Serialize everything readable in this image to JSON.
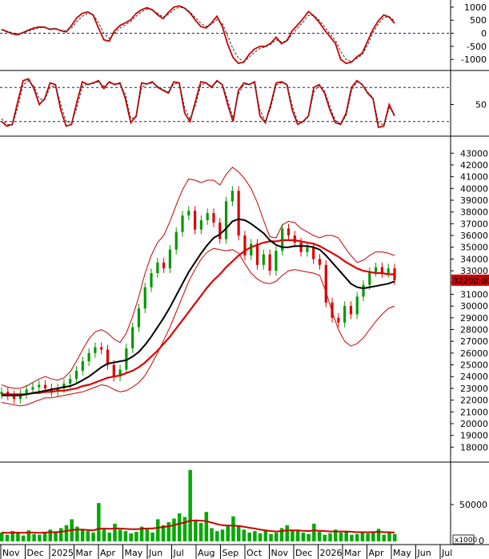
{
  "chart_data": [
    {
      "panel": "macd",
      "type": "line",
      "y_ticks": [
        "1000",
        "500",
        "0",
        "-500",
        "-1000"
      ],
      "y_tick_values": [
        1000,
        500,
        0,
        -500,
        -1000
      ],
      "ylim": [
        -1300,
        1150
      ],
      "reference_lines": [
        0
      ],
      "series": [
        {
          "color": "#cc0000",
          "style": "solid",
          "values": [
            150,
            60,
            -20,
            -60,
            30,
            120,
            200,
            240,
            230,
            150,
            180,
            100,
            50,
            300,
            600,
            760,
            820,
            700,
            200,
            -250,
            -300,
            100,
            300,
            400,
            520,
            760,
            900,
            980,
            900,
            700,
            560,
            800,
            1000,
            1050,
            960,
            780,
            500,
            260,
            200,
            400,
            650,
            260,
            -420,
            -930,
            -1150,
            -1100,
            -800,
            -600,
            -500,
            -500,
            -380,
            -150,
            -400,
            -280,
            100,
            320,
            560,
            830,
            660,
            420,
            120,
            -130,
            -380,
            -1000,
            -1150,
            -1100,
            -900,
            -760,
            -300,
            150,
            480,
            700,
            620,
            380
          ]
        },
        {
          "color": "#333333",
          "style": "dashed",
          "values": [
            120,
            80,
            20,
            -20,
            10,
            80,
            160,
            210,
            220,
            170,
            170,
            120,
            80,
            200,
            450,
            650,
            760,
            720,
            400,
            0,
            -200,
            0,
            200,
            330,
            450,
            650,
            820,
            920,
            900,
            760,
            620,
            720,
            900,
            1000,
            960,
            820,
            600,
            380,
            260,
            340,
            520,
            380,
            -100,
            -600,
            -950,
            -1080,
            -920,
            -720,
            -580,
            -520,
            -420,
            -250,
            -330,
            -300,
            -40,
            200,
            430,
            680,
            680,
            500,
            250,
            -30,
            -260,
            -700,
            -1000,
            -1080,
            -960,
            -820,
            -450,
            20,
            360,
            600,
            640,
            480
          ]
        }
      ]
    },
    {
      "panel": "stochastic",
      "type": "line",
      "y_ticks": [
        "50"
      ],
      "y_tick_values": [
        50
      ],
      "ylim": [
        0,
        100
      ],
      "reference_lines": [
        80,
        20
      ],
      "series": [
        {
          "color": "#cc0000",
          "style": "solid",
          "values": [
            20,
            12,
            15,
            55,
            92,
            95,
            78,
            50,
            60,
            88,
            85,
            40,
            12,
            15,
            55,
            90,
            85,
            88,
            92,
            78,
            90,
            85,
            88,
            60,
            18,
            30,
            88,
            86,
            90,
            80,
            75,
            70,
            90,
            88,
            35,
            20,
            55,
            90,
            88,
            80,
            92,
            85,
            50,
            20,
            75,
            88,
            85,
            90,
            30,
            18,
            50,
            88,
            90,
            85,
            40,
            15,
            20,
            30,
            80,
            85,
            70,
            40,
            18,
            15,
            35,
            80,
            92,
            85,
            70,
            60,
            10,
            12,
            50,
            30
          ]
        },
        {
          "color": "#333333",
          "style": "dashed",
          "values": [
            25,
            15,
            14,
            45,
            85,
            92,
            82,
            60,
            58,
            80,
            84,
            50,
            20,
            18,
            45,
            82,
            86,
            87,
            90,
            82,
            88,
            86,
            86,
            68,
            25,
            28,
            80,
            86,
            88,
            82,
            76,
            72,
            86,
            88,
            45,
            24,
            48,
            84,
            88,
            82,
            90,
            86,
            58,
            26,
            68,
            85,
            86,
            88,
            40,
            20,
            44,
            84,
            88,
            86,
            48,
            20,
            20,
            28,
            72,
            84,
            74,
            46,
            22,
            16,
            30,
            74,
            90,
            86,
            72,
            62,
            18,
            14,
            44,
            32
          ]
        }
      ]
    },
    {
      "panel": "price",
      "type": "candlestick",
      "y_ticks": [
        "43000",
        "42000",
        "41000",
        "40000",
        "39000",
        "38000",
        "37000",
        "36000",
        "35000",
        "34000",
        "33000",
        "32000",
        "31000",
        "30000",
        "29000",
        "28000",
        "27000",
        "26000",
        "25000",
        "24000",
        "23000",
        "22000",
        "21000",
        "20000",
        "19000",
        "18000"
      ],
      "y_tick_values": [
        43000,
        42000,
        41000,
        40000,
        39000,
        38000,
        37000,
        36000,
        35000,
        34000,
        33000,
        32000,
        31000,
        30000,
        29000,
        28000,
        27000,
        26000,
        25000,
        24000,
        23000,
        22000,
        21000,
        20000,
        19000,
        18000
      ],
      "ylim": [
        17000,
        43700
      ],
      "last_price_label": "32200.00",
      "last_price": 32200,
      "closes": [
        22700,
        22400,
        22100,
        22500,
        22900,
        23100,
        23300,
        23000,
        22700,
        23000,
        23400,
        23800,
        24500,
        25300,
        26000,
        26500,
        26300,
        25000,
        24000,
        24600,
        26400,
        28200,
        29800,
        31600,
        32800,
        33700,
        33200,
        34800,
        36300,
        37700,
        38100,
        36500,
        37300,
        37900,
        37100,
        35700,
        38900,
        39800,
        36000,
        34300,
        35300,
        33500,
        34400,
        33000,
        34700,
        36600,
        36000,
        35400,
        34600,
        35000,
        34000,
        33500,
        30300,
        29000,
        28600,
        30000,
        29300,
        30800,
        31800,
        32900,
        33300,
        32800,
        33200,
        32200
      ],
      "opens": [
        22500,
        22700,
        22400,
        22100,
        22500,
        22900,
        23100,
        23300,
        23000,
        22700,
        23000,
        23400,
        23800,
        24500,
        25300,
        26000,
        26500,
        26300,
        25000,
        24000,
        24600,
        26400,
        28200,
        29800,
        31600,
        32800,
        33700,
        33200,
        34800,
        36300,
        37700,
        38100,
        36500,
        37300,
        37900,
        37100,
        35700,
        38900,
        39800,
        36000,
        34300,
        35300,
        33500,
        34400,
        33000,
        34700,
        36600,
        36000,
        35400,
        34600,
        35000,
        34000,
        33500,
        30300,
        29000,
        28600,
        30000,
        29300,
        30800,
        31800,
        32900,
        33300,
        32800,
        33200
      ],
      "bb_upper": [
        23300,
        23100,
        23000,
        23000,
        23200,
        23500,
        23800,
        24000,
        23800,
        23700,
        23900,
        24400,
        25300,
        26300,
        27200,
        27800,
        28000,
        27700,
        27200,
        26900,
        27700,
        29100,
        30800,
        32800,
        34300,
        35400,
        36000,
        37200,
        38600,
        39900,
        40800,
        40700,
        40500,
        40700,
        40700,
        40300,
        41200,
        41800,
        41400,
        40800,
        40000,
        38800,
        37300,
        35900,
        35800,
        36900,
        37200,
        37100,
        36600,
        36300,
        36000,
        35800,
        36000,
        36000,
        35800,
        35000,
        34300,
        33700,
        33900,
        34300,
        34600,
        34600,
        34500,
        34300
      ],
      "bb_lower": [
        21800,
        21700,
        21600,
        21500,
        21600,
        21800,
        22000,
        22200,
        22200,
        22300,
        22400,
        22500,
        22600,
        22700,
        22900,
        23100,
        23300,
        23200,
        22900,
        22700,
        22800,
        23100,
        23500,
        24100,
        25000,
        26000,
        27100,
        28200,
        29500,
        30800,
        32100,
        33100,
        34000,
        34600,
        34900,
        34800,
        34700,
        34800,
        34500,
        33600,
        32800,
        32300,
        32000,
        31900,
        32100,
        32600,
        33000,
        33100,
        33000,
        32900,
        32800,
        32600,
        31200,
        29500,
        28000,
        27000,
        26600,
        26800,
        27300,
        28000,
        28700,
        29300,
        29800,
        30000
      ],
      "ma_black": [
        22400,
        22400,
        22400,
        22400,
        22500,
        22600,
        22700,
        22800,
        22900,
        23000,
        23100,
        23200,
        23400,
        23700,
        24000,
        24400,
        24800,
        25100,
        25200,
        25300,
        25400,
        25700,
        26100,
        26700,
        27400,
        28200,
        29000,
        29900,
        30900,
        31900,
        32900,
        33700,
        34500,
        35200,
        35800,
        36100,
        36600,
        37200,
        37400,
        37300,
        37000,
        36600,
        36200,
        35600,
        35200,
        35000,
        35000,
        35100,
        35100,
        35100,
        35000,
        34800,
        34300,
        33700,
        33100,
        32500,
        31900,
        31600,
        31500,
        31600,
        31700,
        31800,
        31900,
        32100
      ],
      "ma_red": [
        22500,
        22500,
        22500,
        22500,
        22500,
        22600,
        22600,
        22700,
        22700,
        22800,
        22800,
        22900,
        23000,
        23200,
        23300,
        23500,
        23700,
        23900,
        24000,
        24100,
        24300,
        24500,
        24800,
        25200,
        25700,
        26200,
        26800,
        27400,
        28100,
        28800,
        29500,
        30200,
        30900,
        31600,
        32200,
        32700,
        33300,
        33800,
        34300,
        34700,
        35000,
        35200,
        35400,
        35500,
        35500,
        35600,
        35600,
        35600,
        35500,
        35400,
        35300,
        35100,
        34800,
        34500,
        34200,
        33800,
        33500,
        33200,
        33000,
        32900,
        32800,
        32800,
        32700,
        32700
      ]
    },
    {
      "panel": "volume",
      "type": "bar",
      "y_ticks": [
        "50000"
      ],
      "y_tick_values": [
        50000
      ],
      "unit_label": "x1000",
      "zero_label": "0",
      "ylim": [
        0,
        100000
      ],
      "values": [
        12000,
        9000,
        14000,
        11000,
        8000,
        15000,
        10000,
        9000,
        13000,
        16000,
        12000,
        18000,
        22000,
        30000,
        20000,
        16000,
        14000,
        12000,
        52000,
        18000,
        12000,
        24000,
        16000,
        14000,
        11000,
        13000,
        20000,
        18000,
        12000,
        30000,
        22000,
        26000,
        31000,
        38000,
        33000,
        97000,
        28000,
        25000,
        40000,
        18000,
        14000,
        16000,
        22000,
        34000,
        21000,
        16000,
        12000,
        14000,
        11000,
        15000,
        10000,
        12000,
        18000,
        22000,
        14000,
        15000,
        12000,
        10000,
        24000,
        13000,
        9000,
        11000,
        16000,
        12000,
        14000,
        9000,
        10000,
        12000,
        11000,
        13000,
        17000,
        9000,
        12000,
        10000
      ],
      "ma_values": [
        12000,
        11500,
        11800,
        11800,
        11500,
        12000,
        12000,
        11500,
        12000,
        12500,
        12500,
        13000,
        14000,
        15500,
        16000,
        16000,
        15500,
        15000,
        17000,
        17500,
        17000,
        17500,
        17500,
        17000,
        16500,
        16500,
        17000,
        17500,
        17500,
        18500,
        19500,
        20500,
        22000,
        24000,
        25500,
        28000,
        28500,
        28000,
        27500,
        25500,
        23500,
        22000,
        21500,
        21500,
        21000,
        20000,
        18500,
        17500,
        16000,
        15000,
        14000,
        13500,
        14000,
        15000,
        15000,
        15000,
        14500,
        14000,
        15000,
        14500,
        14000,
        13500,
        13500,
        13500,
        13500,
        13000,
        12500,
        12500,
        12500,
        12500,
        13000,
        12500,
        12500,
        12000
      ]
    }
  ],
  "x_axis": {
    "labels": [
      "Nov",
      "Dec",
      "2025",
      "Mar",
      "Apr",
      "May",
      "Jun",
      "Jul",
      "Aug",
      "Sep",
      "Oct",
      "Nov",
      "Dec",
      "2026",
      "Mar",
      "Apr",
      "May",
      "Jun",
      "Jul"
    ]
  },
  "colors": {
    "up_candle": "#009900",
    "down_candle": "#dd0000",
    "bollinger": "#cc0000",
    "ma_long": "#dd0000",
    "ma_short": "#000000",
    "grid_dashed": "#1a1a5e",
    "price_label_bg": "#cc0000",
    "volume_bar": "#00aa00",
    "volume_ma": "#cc0000"
  }
}
